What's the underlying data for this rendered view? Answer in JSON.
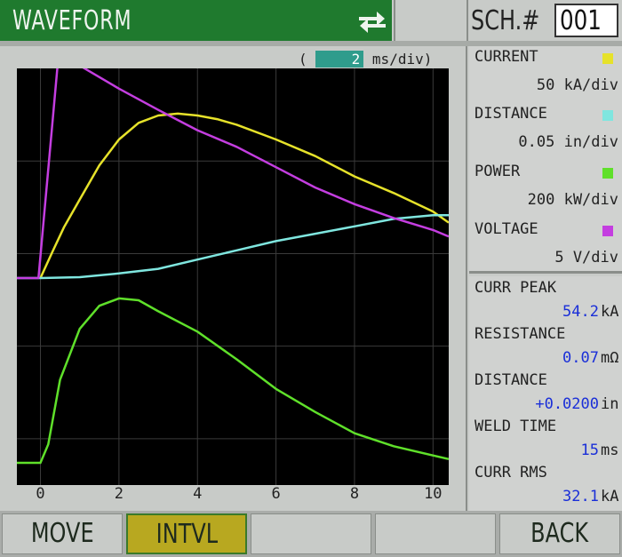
{
  "header": {
    "title": "WAVEFORM",
    "schedule_label": "SCH.#",
    "schedule_value": "001"
  },
  "timebase": {
    "open": "(",
    "value": "2",
    "unit": "ms/div)"
  },
  "channels": [
    {
      "name": "CURRENT",
      "scale": "50 kA/div",
      "color": "#e6e22a"
    },
    {
      "name": "DISTANCE",
      "scale": "0.05 in/div",
      "color": "#7fe6df"
    },
    {
      "name": "POWER",
      "scale": "200 kW/div",
      "color": "#5fe02a"
    },
    {
      "name": "VOLTAGE",
      "scale": "5  V/div",
      "color": "#c43ee0"
    }
  ],
  "readouts": [
    {
      "label": "CURR PEAK",
      "value": "54.2",
      "unit": "kA"
    },
    {
      "label": "RESISTANCE",
      "value": "0.07",
      "unit": "mΩ"
    },
    {
      "label": "DISTANCE",
      "value": "+0.0200",
      "unit": "in"
    },
    {
      "label": "WELD TIME",
      "value": "15",
      "unit": "ms"
    },
    {
      "label": "CURR RMS",
      "value": "32.1",
      "unit": "kA"
    }
  ],
  "softkeys": [
    "MOVE",
    "INTVL",
    "",
    "",
    "BACK"
  ],
  "icons": {
    "swap": "swap-arrows-icon"
  },
  "chart_data": {
    "type": "line",
    "xlim": [
      -0.6,
      10.4
    ],
    "xticks": [
      0,
      2,
      4,
      6,
      8,
      10
    ],
    "grid": "on",
    "series": [
      {
        "name": "CURRENT",
        "color": "#e6e22a",
        "x": [
          0,
          0.3,
          0.6,
          1,
          1.5,
          2,
          2.5,
          3,
          3.5,
          4,
          4.5,
          5,
          6,
          7,
          8,
          9,
          10,
          10.4
        ],
        "y": [
          0,
          0.28,
          0.55,
          0.85,
          1.22,
          1.5,
          1.68,
          1.76,
          1.78,
          1.76,
          1.72,
          1.66,
          1.5,
          1.32,
          1.1,
          0.92,
          0.72,
          0.6
        ]
      },
      {
        "name": "DISTANCE",
        "color": "#7fe6df",
        "x": [
          -0.6,
          0,
          1,
          2,
          3,
          4,
          5,
          6,
          7,
          8,
          9,
          10,
          10.4
        ],
        "y": [
          0,
          0,
          0.01,
          0.05,
          0.1,
          0.2,
          0.3,
          0.4,
          0.48,
          0.56,
          0.64,
          0.68,
          0.68
        ]
      },
      {
        "name": "VOLTAGE",
        "color": "#c43ee0",
        "x": [
          -0.6,
          -0.05,
          0.5,
          1,
          2,
          3,
          4,
          5,
          6,
          7,
          8,
          9,
          10,
          10.4
        ],
        "y": [
          0,
          0,
          2.6,
          2.3,
          2.05,
          1.82,
          1.6,
          1.42,
          1.2,
          0.98,
          0.8,
          0.65,
          0.52,
          0.45
        ]
      },
      {
        "name": "POWER",
        "color": "#5fe02a",
        "x": [
          -0.6,
          0,
          0.2,
          0.5,
          1,
          1.5,
          2,
          2.5,
          3,
          4,
          5,
          6,
          7,
          8,
          9,
          10,
          10.4
        ],
        "y": [
          -2.0,
          -2.0,
          -1.8,
          -1.1,
          -0.55,
          -0.3,
          -0.22,
          -0.24,
          -0.36,
          -0.58,
          -0.88,
          -1.2,
          -1.45,
          -1.68,
          -1.82,
          -1.92,
          -1.96
        ]
      }
    ]
  }
}
